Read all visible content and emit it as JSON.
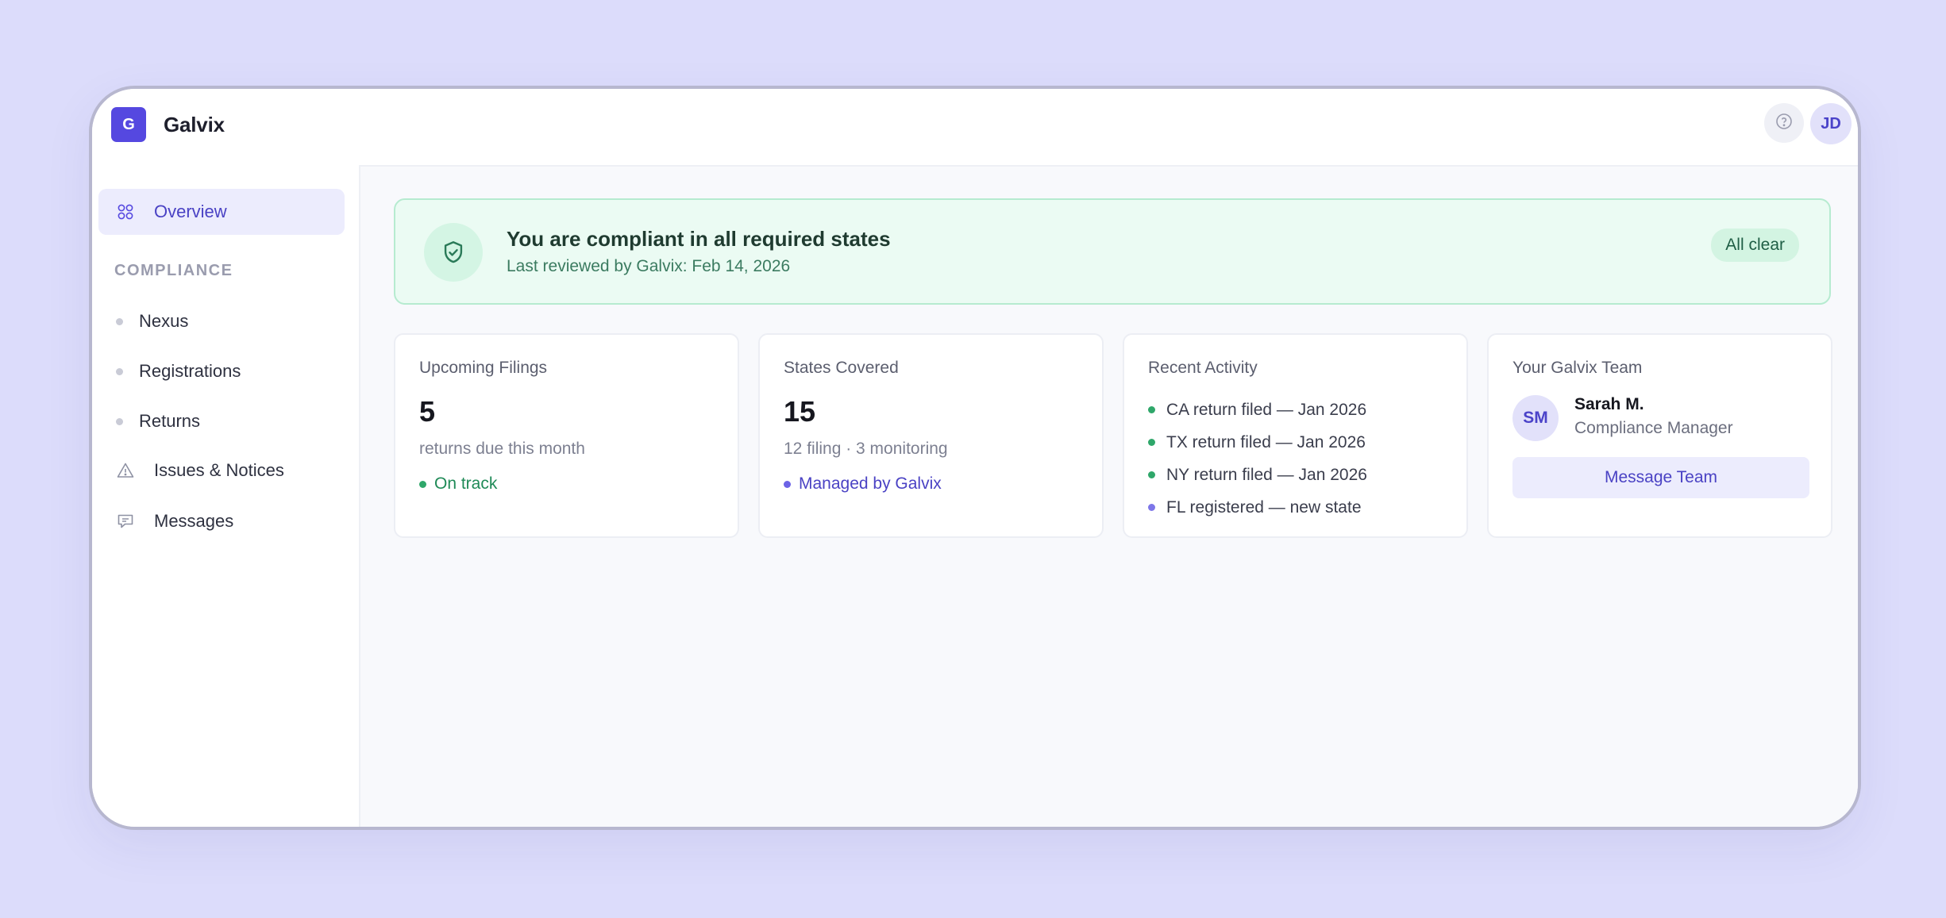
{
  "app": {
    "logo_letter": "G",
    "name": "Galvix",
    "user_initials": "JD"
  },
  "colors": {
    "accent": "#5548e0",
    "success": "#2fa76a",
    "background": "#dcdcfb"
  },
  "icons": {
    "help": "help-circle-icon",
    "overview": "grid-icon",
    "issues": "warning-triangle-icon",
    "messages": "message-icon",
    "banner": "shield-check-icon"
  },
  "sidebar": {
    "overview_label": "Overview",
    "section_label": "COMPLIANCE",
    "compliance_items": [
      "Nexus",
      "Registrations",
      "Returns"
    ],
    "issues_label": "Issues & Notices",
    "messages_label": "Messages"
  },
  "banner": {
    "title": "You are compliant in all required states",
    "subtitle": "Last reviewed by Galvix: Feb 14, 2026",
    "badge": "All clear"
  },
  "cards": {
    "filings": {
      "title": "Upcoming Filings",
      "value": "5",
      "subtitle": "returns due this month",
      "status": "On track"
    },
    "states": {
      "title": "States Covered",
      "value": "15",
      "subtitle": "12 filing · 3 monitoring",
      "status": "Managed by Galvix"
    },
    "activity": {
      "title": "Recent Activity",
      "items": [
        "CA return filed — Jan 2026",
        "TX return filed — Jan 2026",
        "NY return filed — Jan 2026",
        "FL registered — new state"
      ]
    },
    "team": {
      "title": "Your Galvix Team",
      "initials": "SM",
      "name": "Sarah M.",
      "role": "Compliance Manager",
      "button": "Message Team"
    }
  }
}
